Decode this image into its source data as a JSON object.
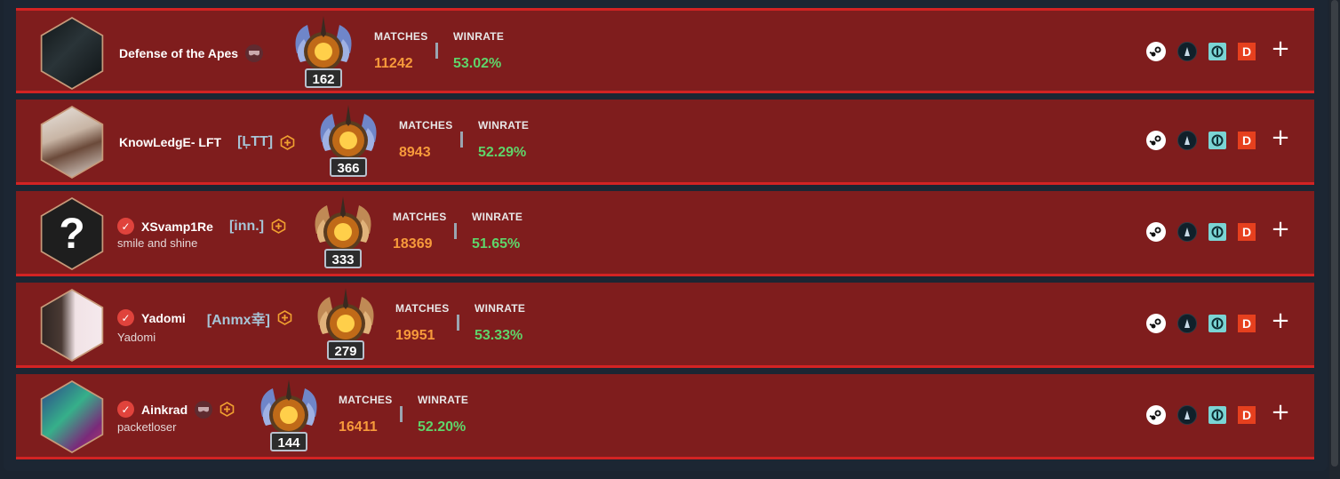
{
  "labels": {
    "matches": "MATCHES",
    "winrate": "WINRATE"
  },
  "colors": {
    "row_bg": "#7f1d1d",
    "row_border": "#d32323",
    "matches": "#f79a3b",
    "winrate": "#5fd46a"
  },
  "players": [
    {
      "name": "Defense of the Apes",
      "tag": "",
      "subtitle": "",
      "verified": false,
      "mask": true,
      "plus": false,
      "rank": "162",
      "matches": "11242",
      "winrate": "53.02%"
    },
    {
      "name": "KnowLedgE- LFT",
      "tag": "[ĻTT]",
      "subtitle": "",
      "verified": false,
      "mask": false,
      "plus": true,
      "rank": "366",
      "matches": "8943",
      "winrate": "52.29%"
    },
    {
      "name": "XSvamp1Re",
      "tag": "[inn.]",
      "subtitle": "smile and shine",
      "verified": true,
      "mask": false,
      "plus": true,
      "rank": "333",
      "matches": "18369",
      "winrate": "51.65%"
    },
    {
      "name": "Yadomi",
      "tag": "[Anmx幸]",
      "subtitle": "Yadomi",
      "verified": true,
      "mask": false,
      "plus": true,
      "rank": "279",
      "matches": "19951",
      "winrate": "53.33%"
    },
    {
      "name": "Ainkrad",
      "tag": "",
      "subtitle": "packetloser",
      "verified": true,
      "mask": true,
      "plus": true,
      "rank": "144",
      "matches": "16411",
      "winrate": "52.20%"
    }
  ],
  "icons": {
    "steam": "steam-icon",
    "profile": "profile-site-icon",
    "opendota": "opendota-icon",
    "dotabuff": "dotabuff-icon",
    "dotabuff_letter": "D",
    "add": "plus-icon",
    "add_symbol": "+",
    "verified_symbol": "✓",
    "question_symbol": "?"
  }
}
